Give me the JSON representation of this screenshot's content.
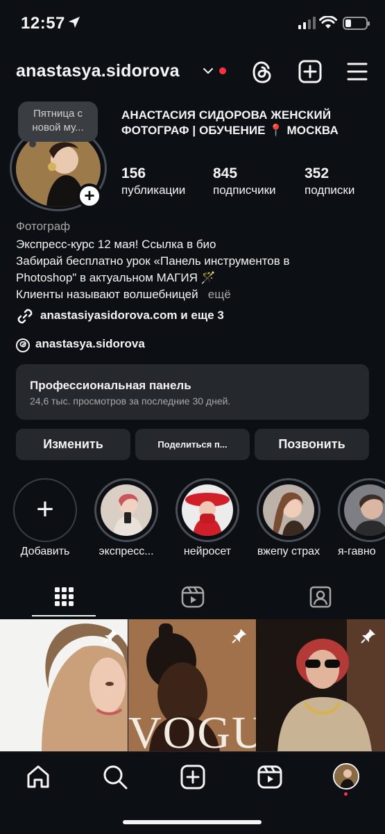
{
  "status_bar": {
    "time": "12:57"
  },
  "header": {
    "username": "anastasya.sidorova",
    "icons": [
      "threads-icon",
      "create-icon",
      "menu-icon"
    ]
  },
  "profile": {
    "note": "Пятница с новой му...",
    "full_name": "АНАСТАСИЯ СИДОРОВА ЖЕНСКИЙ ФОТОГРАФ | ОБУЧЕНИЕ 📍 МОСКВА",
    "stats": [
      {
        "value": "156",
        "label": "публикации"
      },
      {
        "value": "845",
        "label": "подписчики"
      },
      {
        "value": "352",
        "label": "подписки"
      }
    ],
    "category": "Фотограф",
    "bio": [
      "Экспресс-курс 12 мая! Ссылка в био",
      "Забирай бесплатно урок «Панель инструментов в",
      "Photoshop\" в актуальном МАГИЯ 🪄",
      "Клиенты называют волшебницей"
    ],
    "bio_more": "ещё",
    "link": "anastasiyasidorova.com и еще 3",
    "threads_handle": "anastasya.sidorova"
  },
  "dashboard": {
    "title": "Профессиональная панель",
    "subtitle": "24,6 тыс. просмотров за последние 30 дней."
  },
  "buttons": {
    "edit": "Изменить",
    "share": "Поделиться п...",
    "call": "Позвонить"
  },
  "highlights": [
    {
      "label": "Добавить"
    },
    {
      "label": "экспресс..."
    },
    {
      "label": "нейросет"
    },
    {
      "label": "вжепу страх"
    },
    {
      "label": "я-гавно"
    }
  ],
  "posts": [
    {
      "pinned": true
    },
    {
      "pinned": true,
      "overlay_text": "VOGUE"
    },
    {
      "pinned": true
    }
  ],
  "colors": {
    "background": "#0c1014",
    "surface": "#25292e",
    "notification": "#ff3040",
    "muted_text": "#a8a8a8"
  }
}
